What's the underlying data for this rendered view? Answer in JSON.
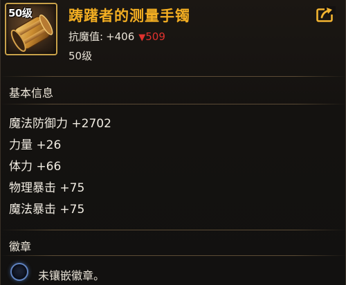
{
  "item": {
    "icon": "bracer-icon",
    "level_badge": "50级",
    "title": "踌躇者的测量手镯",
    "resistance_label": "抗魔值:",
    "resistance_value": "+406",
    "resistance_diff": "509",
    "resistance_diff_direction": "down",
    "level_text": "50级"
  },
  "share_icon": "share-export-icon",
  "sections": {
    "basic_info_title": "基本信息",
    "attributes": [
      "魔法防御力 +2702",
      "力量 +26",
      "体力 +66",
      "物理暴击 +75",
      "魔法暴击 +75"
    ],
    "emblem_title": "徽章",
    "emblem_empty_text": "未镶嵌徽章。"
  },
  "colors": {
    "title": "#f3ae22",
    "decrease": "#e0322e",
    "frame_gold": "#c9a24a",
    "emblem_glow": "#5f82bf"
  }
}
